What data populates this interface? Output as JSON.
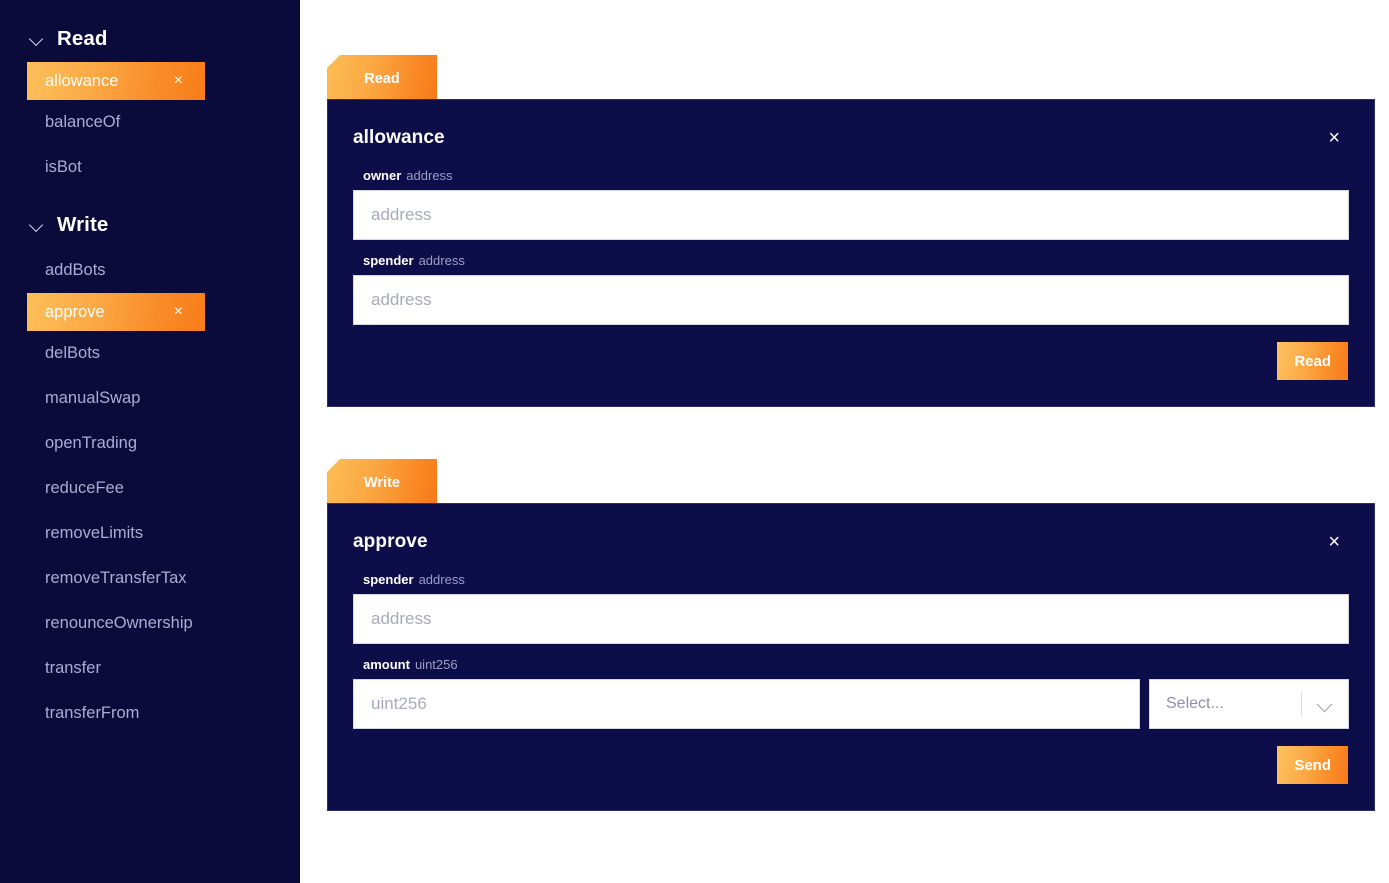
{
  "sidebar": {
    "sections": [
      {
        "label": "Read",
        "chevron_icon": "chevron-down-icon",
        "items": [
          {
            "label": "allowance",
            "active": true,
            "close_icon": "×"
          },
          {
            "label": "balanceOf",
            "active": false
          },
          {
            "label": "isBot",
            "active": false
          }
        ]
      },
      {
        "label": "Write",
        "chevron_icon": "chevron-down-icon",
        "items": [
          {
            "label": "addBots",
            "active": false
          },
          {
            "label": "approve",
            "active": true,
            "close_icon": "×"
          },
          {
            "label": "delBots",
            "active": false
          },
          {
            "label": "manualSwap",
            "active": false
          },
          {
            "label": "openTrading",
            "active": false
          },
          {
            "label": "reduceFee",
            "active": false
          },
          {
            "label": "removeLimits",
            "active": false
          },
          {
            "label": "removeTransferTax",
            "active": false
          },
          {
            "label": "renounceOwnership",
            "active": false
          },
          {
            "label": "transfer",
            "active": false
          },
          {
            "label": "transferFrom",
            "active": false
          }
        ]
      }
    ]
  },
  "panels": [
    {
      "tab_label": "Read",
      "title": "allowance",
      "close_icon": "×",
      "fields": [
        {
          "name": "owner",
          "type": "address",
          "value": "",
          "placeholder": "address",
          "has_select": false
        },
        {
          "name": "spender",
          "type": "address",
          "value": "",
          "placeholder": "address",
          "has_select": false
        }
      ],
      "action_label": "Read"
    },
    {
      "tab_label": "Write",
      "title": "approve",
      "close_icon": "×",
      "fields": [
        {
          "name": "spender",
          "type": "address",
          "value": "",
          "placeholder": "address",
          "has_select": false
        },
        {
          "name": "amount",
          "type": "uint256",
          "value": "",
          "placeholder": "uint256",
          "has_select": true,
          "select_value": "Select...",
          "select_chevron_icon": "chevron-down-icon"
        }
      ],
      "action_label": "Send"
    }
  ],
  "colors": {
    "sidebar_bg": "#0b0b3b",
    "panel_bg": "#0d0d4a",
    "page_bg": "#ffffff",
    "accent_orange_light": "#fcbf5a",
    "accent_orange_dark": "#f7791a",
    "muted_text": "#a9add0"
  }
}
